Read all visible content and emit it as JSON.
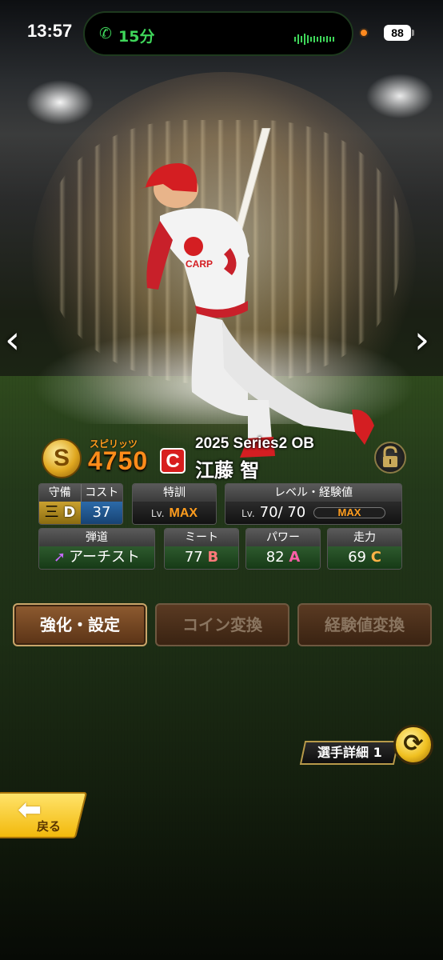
{
  "status_bar": {
    "time": "13:57",
    "call_duration": "15分",
    "battery": "88",
    "call_color": "#3fd65a",
    "recording_color": "#ff8a1f"
  },
  "nav": {
    "prev": "‹",
    "next": "›"
  },
  "card": {
    "spirit_coin_letter": "S",
    "spirit_label": "スピリッツ",
    "spirits": "4750",
    "team_logo": "C",
    "series": "2025 Series2 OB",
    "player_name": "江藤 智",
    "lock_icon": "lock-icon"
  },
  "stats": {
    "defense": {
      "label": "守備",
      "position": "三",
      "grade": "D"
    },
    "cost": {
      "label": "コスト",
      "value": "37"
    },
    "training": {
      "label": "特訓",
      "lv": "Lv.",
      "value": "MAX"
    },
    "level": {
      "label": "レベル・経験値",
      "lv": "Lv.",
      "value": "70/ 70",
      "exp": "MAX"
    },
    "trajectory": {
      "label": "弾道",
      "value": "アーチスト",
      "icon": "arrow-up-right-icon"
    },
    "contact": {
      "label": "ミート",
      "value": "77",
      "grade": "B"
    },
    "power": {
      "label": "パワー",
      "value": "82",
      "grade": "A"
    },
    "speed": {
      "label": "走力",
      "value": "69",
      "grade": "C"
    }
  },
  "actions": {
    "enhance": "強化・設定",
    "coin_convert": "コイン変換",
    "exp_convert": "経験値変換"
  },
  "detail": {
    "label": "選手詳細 1"
  },
  "back": {
    "label": "戻る"
  }
}
